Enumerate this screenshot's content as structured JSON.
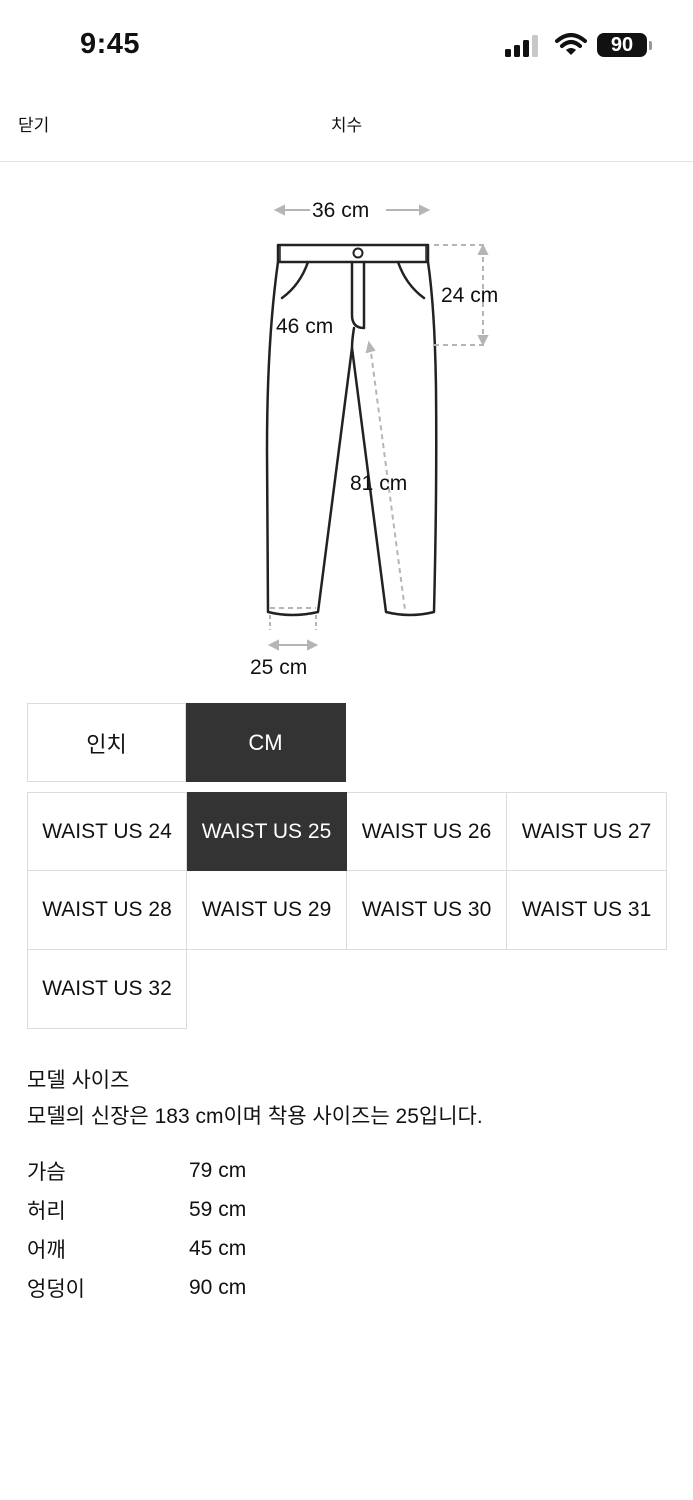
{
  "status_bar": {
    "time": "9:45",
    "battery": "90"
  },
  "nav": {
    "close_label": "닫기",
    "title": "치수"
  },
  "diagram": {
    "waist_width": "36 cm",
    "rise": "24 cm",
    "hip_width": "46 cm",
    "inseam": "81 cm",
    "hem_width": "25 cm"
  },
  "unit_toggle": [
    {
      "label": "인치",
      "active": false
    },
    {
      "label": "CM",
      "active": true
    }
  ],
  "sizes": [
    {
      "label": "WAIST US 24",
      "active": false
    },
    {
      "label": "WAIST US 25",
      "active": true
    },
    {
      "label": "WAIST US 26",
      "active": false
    },
    {
      "label": "WAIST US 27",
      "active": false
    },
    {
      "label": "WAIST US 28",
      "active": false
    },
    {
      "label": "WAIST US 29",
      "active": false
    },
    {
      "label": "WAIST US 30",
      "active": false
    },
    {
      "label": "WAIST US 31",
      "active": false
    },
    {
      "label": "WAIST US 32",
      "active": false
    }
  ],
  "model": {
    "title": "모델 사이즈",
    "description": "모델의 신장은 183 cm이며 착용 사이즈는 25입니다.",
    "measurements": [
      {
        "label": "가슴",
        "value": "79 cm"
      },
      {
        "label": "허리",
        "value": "59 cm"
      },
      {
        "label": "어깨",
        "value": "45 cm"
      },
      {
        "label": "엉덩이",
        "value": "90 cm"
      }
    ]
  },
  "colors": {
    "active": "#333333",
    "border": "#dcdcdc",
    "text": "#111111"
  },
  "icons": [
    "signal-icon",
    "wifi-icon",
    "battery-icon",
    "pants-diagram"
  ]
}
